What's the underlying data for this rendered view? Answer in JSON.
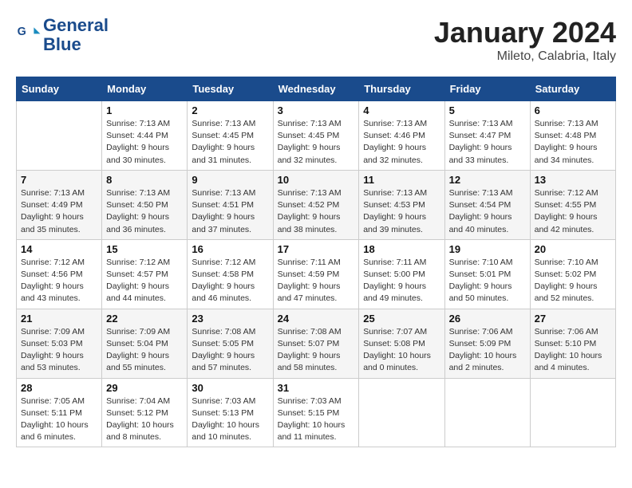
{
  "header": {
    "logo_line1": "General",
    "logo_line2": "Blue",
    "month_title": "January 2024",
    "location": "Mileto, Calabria, Italy"
  },
  "columns": [
    "Sunday",
    "Monday",
    "Tuesday",
    "Wednesday",
    "Thursday",
    "Friday",
    "Saturday"
  ],
  "weeks": [
    [
      {
        "day": "",
        "info": ""
      },
      {
        "day": "1",
        "info": "Sunrise: 7:13 AM\nSunset: 4:44 PM\nDaylight: 9 hours\nand 30 minutes."
      },
      {
        "day": "2",
        "info": "Sunrise: 7:13 AM\nSunset: 4:45 PM\nDaylight: 9 hours\nand 31 minutes."
      },
      {
        "day": "3",
        "info": "Sunrise: 7:13 AM\nSunset: 4:45 PM\nDaylight: 9 hours\nand 32 minutes."
      },
      {
        "day": "4",
        "info": "Sunrise: 7:13 AM\nSunset: 4:46 PM\nDaylight: 9 hours\nand 32 minutes."
      },
      {
        "day": "5",
        "info": "Sunrise: 7:13 AM\nSunset: 4:47 PM\nDaylight: 9 hours\nand 33 minutes."
      },
      {
        "day": "6",
        "info": "Sunrise: 7:13 AM\nSunset: 4:48 PM\nDaylight: 9 hours\nand 34 minutes."
      }
    ],
    [
      {
        "day": "7",
        "info": "Sunrise: 7:13 AM\nSunset: 4:49 PM\nDaylight: 9 hours\nand 35 minutes."
      },
      {
        "day": "8",
        "info": "Sunrise: 7:13 AM\nSunset: 4:50 PM\nDaylight: 9 hours\nand 36 minutes."
      },
      {
        "day": "9",
        "info": "Sunrise: 7:13 AM\nSunset: 4:51 PM\nDaylight: 9 hours\nand 37 minutes."
      },
      {
        "day": "10",
        "info": "Sunrise: 7:13 AM\nSunset: 4:52 PM\nDaylight: 9 hours\nand 38 minutes."
      },
      {
        "day": "11",
        "info": "Sunrise: 7:13 AM\nSunset: 4:53 PM\nDaylight: 9 hours\nand 39 minutes."
      },
      {
        "day": "12",
        "info": "Sunrise: 7:13 AM\nSunset: 4:54 PM\nDaylight: 9 hours\nand 40 minutes."
      },
      {
        "day": "13",
        "info": "Sunrise: 7:12 AM\nSunset: 4:55 PM\nDaylight: 9 hours\nand 42 minutes."
      }
    ],
    [
      {
        "day": "14",
        "info": "Sunrise: 7:12 AM\nSunset: 4:56 PM\nDaylight: 9 hours\nand 43 minutes."
      },
      {
        "day": "15",
        "info": "Sunrise: 7:12 AM\nSunset: 4:57 PM\nDaylight: 9 hours\nand 44 minutes."
      },
      {
        "day": "16",
        "info": "Sunrise: 7:12 AM\nSunset: 4:58 PM\nDaylight: 9 hours\nand 46 minutes."
      },
      {
        "day": "17",
        "info": "Sunrise: 7:11 AM\nSunset: 4:59 PM\nDaylight: 9 hours\nand 47 minutes."
      },
      {
        "day": "18",
        "info": "Sunrise: 7:11 AM\nSunset: 5:00 PM\nDaylight: 9 hours\nand 49 minutes."
      },
      {
        "day": "19",
        "info": "Sunrise: 7:10 AM\nSunset: 5:01 PM\nDaylight: 9 hours\nand 50 minutes."
      },
      {
        "day": "20",
        "info": "Sunrise: 7:10 AM\nSunset: 5:02 PM\nDaylight: 9 hours\nand 52 minutes."
      }
    ],
    [
      {
        "day": "21",
        "info": "Sunrise: 7:09 AM\nSunset: 5:03 PM\nDaylight: 9 hours\nand 53 minutes."
      },
      {
        "day": "22",
        "info": "Sunrise: 7:09 AM\nSunset: 5:04 PM\nDaylight: 9 hours\nand 55 minutes."
      },
      {
        "day": "23",
        "info": "Sunrise: 7:08 AM\nSunset: 5:05 PM\nDaylight: 9 hours\nand 57 minutes."
      },
      {
        "day": "24",
        "info": "Sunrise: 7:08 AM\nSunset: 5:07 PM\nDaylight: 9 hours\nand 58 minutes."
      },
      {
        "day": "25",
        "info": "Sunrise: 7:07 AM\nSunset: 5:08 PM\nDaylight: 10 hours\nand 0 minutes."
      },
      {
        "day": "26",
        "info": "Sunrise: 7:06 AM\nSunset: 5:09 PM\nDaylight: 10 hours\nand 2 minutes."
      },
      {
        "day": "27",
        "info": "Sunrise: 7:06 AM\nSunset: 5:10 PM\nDaylight: 10 hours\nand 4 minutes."
      }
    ],
    [
      {
        "day": "28",
        "info": "Sunrise: 7:05 AM\nSunset: 5:11 PM\nDaylight: 10 hours\nand 6 minutes."
      },
      {
        "day": "29",
        "info": "Sunrise: 7:04 AM\nSunset: 5:12 PM\nDaylight: 10 hours\nand 8 minutes."
      },
      {
        "day": "30",
        "info": "Sunrise: 7:03 AM\nSunset: 5:13 PM\nDaylight: 10 hours\nand 10 minutes."
      },
      {
        "day": "31",
        "info": "Sunrise: 7:03 AM\nSunset: 5:15 PM\nDaylight: 10 hours\nand 11 minutes."
      },
      {
        "day": "",
        "info": ""
      },
      {
        "day": "",
        "info": ""
      },
      {
        "day": "",
        "info": ""
      }
    ]
  ]
}
